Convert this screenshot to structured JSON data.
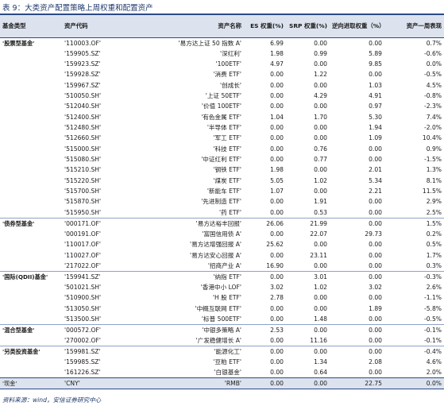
{
  "title": "表 9：大类资产配置策略上周权重和配置资产",
  "headers": [
    "基金类型",
    "资产代码",
    "资产名称",
    "ES 权重(%)",
    "SRP 权重(%)",
    "逆向进取权重（%）",
    "资产一周表现"
  ],
  "groups": [
    {
      "category": "'股票型基金'",
      "rows": [
        [
          "'110003.OF'",
          "'易方达上证 50 指数 A'",
          "6.99",
          "0.00",
          "0.00",
          "0.7%"
        ],
        [
          "'159905.SZ'",
          "'深红利'",
          "1.98",
          "0.99",
          "5.89",
          "-0.6%"
        ],
        [
          "'159923.SZ'",
          "'100ETF'",
          "4.97",
          "0.00",
          "9.85",
          "0.0%"
        ],
        [
          "'159928.SZ'",
          "'消费 ETF'",
          "0.00",
          "1.22",
          "0.00",
          "-0.5%"
        ],
        [
          "'159967.SZ'",
          "'创成长'",
          "0.00",
          "0.00",
          "1.03",
          "4.5%"
        ],
        [
          "'510050.SH'",
          "'上证 50ETF'",
          "0.00",
          "4.29",
          "4.91",
          "-0.8%"
        ],
        [
          "'512040.SH'",
          "'价值 100ETF'",
          "0.00",
          "0.00",
          "0.97",
          "-2.3%"
        ],
        [
          "'512400.SH'",
          "'有色金属 ETF'",
          "1.04",
          "1.70",
          "5.30",
          "7.4%"
        ],
        [
          "'512480.SH'",
          "'半导体 ETF'",
          "0.00",
          "0.00",
          "1.94",
          "-2.0%"
        ],
        [
          "'512660.SH'",
          "'军工 ETF'",
          "0.00",
          "0.00",
          "1.09",
          "10.4%"
        ],
        [
          "'515000.SH'",
          "'科技 ETF'",
          "0.00",
          "0.76",
          "0.00",
          "0.9%"
        ],
        [
          "'515080.SH'",
          "'中证红利 ETF'",
          "0.00",
          "0.77",
          "0.00",
          "-1.5%"
        ],
        [
          "'515210.SH'",
          "'钢铁 ETF'",
          "1.98",
          "0.00",
          "2.01",
          "1.3%"
        ],
        [
          "'515220.SH'",
          "'煤炭 ETF'",
          "5.05",
          "1.02",
          "5.34",
          "8.1%"
        ],
        [
          "'515700.SH'",
          "'新能车 ETF'",
          "1.07",
          "0.00",
          "2.21",
          "11.5%"
        ],
        [
          "'515870.SH'",
          "'先进制造 ETF'",
          "0.00",
          "1.91",
          "0.00",
          "2.9%"
        ],
        [
          "'515950.SH'",
          "'药 ETF'",
          "0.00",
          "0.53",
          "0.00",
          "2.5%"
        ]
      ]
    },
    {
      "category": "'债券型基金'",
      "rows": [
        [
          "'000171.OF'",
          "'易方达裕丰回报'",
          "26.06",
          "21.99",
          "0.00",
          "1.5%"
        ],
        [
          "'000191.OF'",
          "'富国信用债 A'",
          "0.00",
          "22.07",
          "29.73",
          "0.2%"
        ],
        [
          "'110017.OF'",
          "'易方达增强回报 A'",
          "25.62",
          "0.00",
          "0.00",
          "0.5%"
        ],
        [
          "'110027.OF'",
          "'易方达安心回报 A'",
          "0.00",
          "23.11",
          "0.00",
          "1.7%"
        ],
        [
          "'217022.OF'",
          "'招商产业 A'",
          "16.90",
          "0.00",
          "0.00",
          "0.3%"
        ]
      ]
    },
    {
      "category": "'国际(QDII)基金'",
      "rows": [
        [
          "'159941.SZ'",
          "'纳指 ETF'",
          "0.00",
          "3.01",
          "0.00",
          "-0.3%"
        ],
        [
          "'501021.SH'",
          "'香港中小 LOF'",
          "3.02",
          "1.02",
          "3.02",
          "2.6%"
        ],
        [
          "'510900.SH'",
          "'H 股 ETF'",
          "2.78",
          "0.00",
          "0.00",
          "-1.1%"
        ],
        [
          "'513050.SH'",
          "'中概互联网 ETF'",
          "0.00",
          "0.00",
          "1.89",
          "-5.8%"
        ],
        [
          "'513500.SH'",
          "'标普 500ETF'",
          "0.00",
          "1.48",
          "0.00",
          "-0.5%"
        ]
      ]
    },
    {
      "category": "'混合型基金'",
      "rows": [
        [
          "'000572.OF'",
          "'中银多策略 A'",
          "2.53",
          "0.00",
          "0.00",
          "-0.1%"
        ],
        [
          "'270002.OF'",
          "'广发稳健增长 A'",
          "0.00",
          "11.16",
          "0.00",
          "-0.1%"
        ]
      ]
    },
    {
      "category": "'另类投资基金'",
      "rows": [
        [
          "'159981.SZ'",
          "'能源化工'",
          "0.00",
          "0.00",
          "0.00",
          "-0.4%"
        ],
        [
          "'159985.SZ'",
          "'豆粕 ETF'",
          "0.00",
          "1.34",
          "2.08",
          "4.6%"
        ],
        [
          "'161226.SZ'",
          "'白银基金'",
          "0.00",
          "0.64",
          "0.00",
          "2.0%"
        ]
      ]
    }
  ],
  "cash_row": [
    "'现金'",
    "'CNY'",
    "'RMB'",
    "0.00",
    "0.00",
    "22.75",
    "0.0%"
  ],
  "source": "资料来源：wind，安信证券研究中心"
}
